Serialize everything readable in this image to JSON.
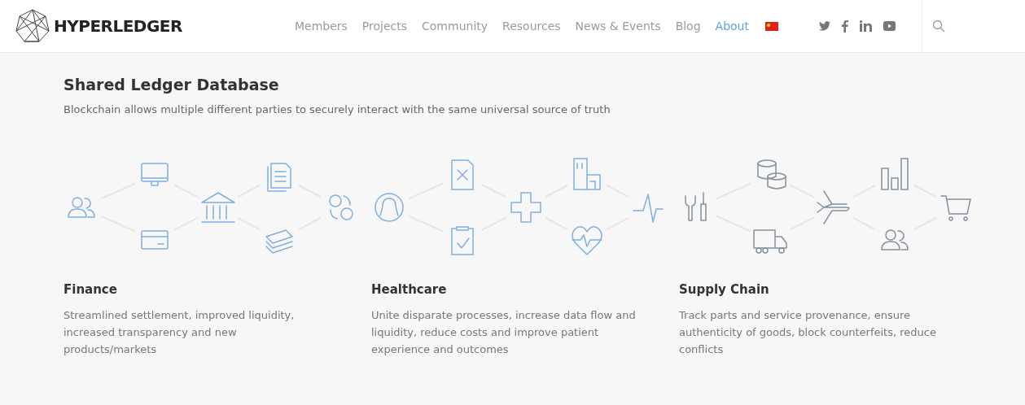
{
  "header": {
    "logo": "HYPERLEDGER",
    "nav": [
      {
        "label": "Members",
        "selected": false
      },
      {
        "label": "Projects",
        "selected": false
      },
      {
        "label": "Community",
        "selected": false
      },
      {
        "label": "Resources",
        "selected": false
      },
      {
        "label": "News & Events",
        "selected": false
      },
      {
        "label": "Blog",
        "selected": false
      },
      {
        "label": "About",
        "selected": true
      }
    ]
  },
  "hero": {
    "title": "Shared Ledger Database",
    "subtitle": "Blockchain allows multiple different parties to securely interact with the same universal source of truth"
  },
  "sectors": [
    {
      "kind": "finance",
      "title": "Finance",
      "description": "Streamlined settlement, improved liquidity, increased transparency and new products/markets"
    },
    {
      "kind": "healthcare",
      "title": "Healthcare",
      "description": "Unite disparate processes, increase data flow and liquidity, reduce costs and improve patient experience and outcomes"
    },
    {
      "kind": "supply",
      "title": "Supply Chain",
      "description": "Track parts and service provenance, ensure authenticity of goods, block counterfeits, reduce conflicts"
    }
  ]
}
